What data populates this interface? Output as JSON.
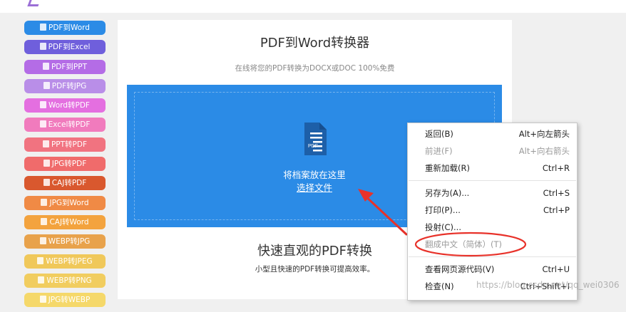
{
  "sidebar": {
    "items": [
      {
        "label": "PDF到Word",
        "color": "#2b8be6"
      },
      {
        "label": "PDF到Excel",
        "color": "#6f5fdc"
      },
      {
        "label": "PDF到PPT",
        "color": "#b46ce6"
      },
      {
        "label": "PDF转JPG",
        "color": "#b98ee8"
      },
      {
        "label": "Word转PDF",
        "color": "#e46fe0"
      },
      {
        "label": "Excel转PDF",
        "color": "#f17bbd"
      },
      {
        "label": "PPT转PDF",
        "color": "#f17380"
      },
      {
        "label": "JPG转PDF",
        "color": "#f06b6b"
      },
      {
        "label": "CAJ转PDF",
        "color": "#d9582e"
      },
      {
        "label": "JPG到Word",
        "color": "#f08a45"
      },
      {
        "label": "CAJ转Word",
        "color": "#f3a33e"
      },
      {
        "label": "WEBP转JPG",
        "color": "#e8a24b"
      },
      {
        "label": "WEBP转JPEG",
        "color": "#f0c85a"
      },
      {
        "label": "WEBP转PNG",
        "color": "#f1cd5f"
      },
      {
        "label": "JPG转WEBP",
        "color": "#f5d86a"
      }
    ]
  },
  "main": {
    "title": "PDF到Word转换器",
    "subtitle": "在线将您的PDF转换为DOCX或DOC 100%免费",
    "dropzone": {
      "icon_text": "PDF",
      "text": "将档案放在这里",
      "choose_file": "选择文件",
      "color": "#2b8be6"
    },
    "section_title": "快速直观的PDF转换",
    "section_subtitle": "小型且快速的PDF转换可提高效率。"
  },
  "context_menu": {
    "items": [
      {
        "label": "返回(B)",
        "shortcut": "Alt+向左箭头",
        "disabled": false
      },
      {
        "label": "前进(F)",
        "shortcut": "Alt+向右箭头",
        "disabled": true
      },
      {
        "label": "重新加载(R)",
        "shortcut": "Ctrl+R",
        "disabled": false
      },
      {
        "label": "另存为(A)...",
        "shortcut": "Ctrl+S",
        "disabled": false
      },
      {
        "label": "打印(P)...",
        "shortcut": "Ctrl+P",
        "disabled": false
      },
      {
        "label": "投射(C)...",
        "shortcut": "",
        "disabled": false
      },
      {
        "label": "翻成中文（简体）(T)",
        "shortcut": "",
        "disabled": true
      },
      {
        "label": "查看网页源代码(V)",
        "shortcut": "Ctrl+U",
        "disabled": false
      },
      {
        "label": "检查(N)",
        "shortcut": "Ctrl+Shift+I",
        "disabled": false
      }
    ]
  },
  "annotations": {
    "arrow_color": "#e8322a",
    "ellipse_color": "#e8322a"
  },
  "watermark": "https://blog.csdn.net/qq_wei0306"
}
